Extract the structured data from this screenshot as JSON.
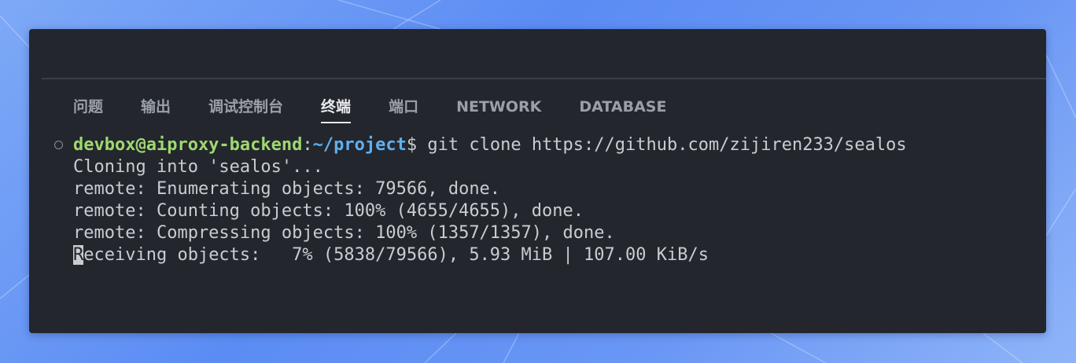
{
  "tabs": [
    {
      "label": "问题",
      "active": false
    },
    {
      "label": "输出",
      "active": false
    },
    {
      "label": "调试控制台",
      "active": false
    },
    {
      "label": "终端",
      "active": true
    },
    {
      "label": "端口",
      "active": false
    },
    {
      "label": "NETWORK",
      "active": false
    },
    {
      "label": "DATABASE",
      "active": false
    }
  ],
  "terminal": {
    "prompt_user_host": "devbox@aiproxy-backend",
    "prompt_sep": ":",
    "prompt_path": "~/project",
    "prompt_dollar": "$",
    "command": " git clone https://github.com/zijiren233/sealos",
    "output": [
      "Cloning into 'sealos'...",
      "remote: Enumerating objects: 79566, done.",
      "remote: Counting objects: 100% (4655/4655), done.",
      "remote: Compressing objects: 100% (1357/1357), done."
    ],
    "progress_cursor_char": "R",
    "progress_rest": "eceiving objects:   7% (5838/79566), 5.93 MiB | 107.00 KiB/s"
  },
  "colors": {
    "background": "#5b8cf3",
    "window": "#23262d",
    "user_host": "#9fd86f",
    "path": "#5fb0f0",
    "text": "#c9ccd1"
  }
}
